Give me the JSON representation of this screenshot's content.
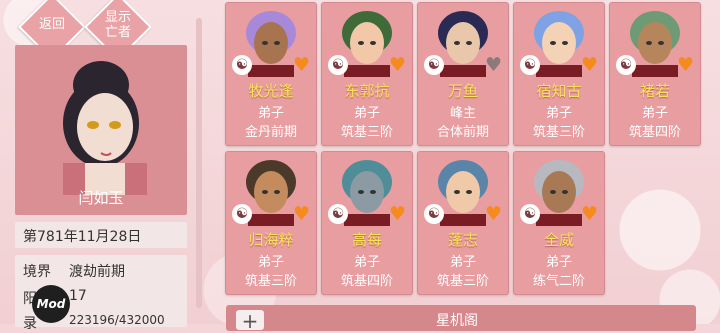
{
  "nav": {
    "back_label": "返回",
    "show_dead_label": "显示\n亡者"
  },
  "character": {
    "name": "闫如玉",
    "date": "第781年11月28日",
    "realm_label": "境界",
    "realm_value": "渡劫前期",
    "age_prefix": "阳",
    "age_value": "17",
    "exp_prefix": "录",
    "exp_value": "223196/432000"
  },
  "disciples": [
    {
      "name": "牧光逢",
      "role": "弟子",
      "rank": "金丹前期",
      "hair": "#a889d9",
      "skin": "#a8744f",
      "heart": "orange"
    },
    {
      "name": "东郭抗",
      "role": "弟子",
      "rank": "筑基三阶",
      "hair": "#3f6b3a",
      "skin": "#f2c8a8",
      "heart": "orange"
    },
    {
      "name": "万鱼",
      "role": "峰主",
      "rank": "合体前期",
      "hair": "#2a2a55",
      "skin": "#e9c7aa",
      "heart": "gray"
    },
    {
      "name": "宿知古",
      "role": "弟子",
      "rank": "筑基三阶",
      "hair": "#7ea2e4",
      "skin": "#f3d2b6",
      "heart": "orange"
    },
    {
      "name": "褚若",
      "role": "弟子",
      "rank": "筑基四阶",
      "hair": "#6f9a76",
      "skin": "#b7855b",
      "heart": "orange"
    },
    {
      "name": "归海粹",
      "role": "弟子",
      "rank": "筑基三阶",
      "hair": "#4b3a2a",
      "skin": "#c48c5e",
      "heart": "orange"
    },
    {
      "name": "高每",
      "role": "弟子",
      "rank": "筑基四阶",
      "hair": "#4f8d99",
      "skin": "#8c9aa3",
      "heart": "orange"
    },
    {
      "name": "蓬志",
      "role": "弟子",
      "rank": "筑基三阶",
      "hair": "#5b84a9",
      "skin": "#f0c9a8",
      "heart": "orange"
    },
    {
      "name": "全威",
      "role": "弟子",
      "rank": "练气二阶",
      "hair": "#b8b8c0",
      "skin": "#a77a55",
      "heart": "orange"
    }
  ],
  "bottom": {
    "plus_label": "+",
    "title": "星机阁"
  },
  "badge": "Mod",
  "colors": {
    "card_bg": "#e89ea1",
    "name_yellow": "#ffe15a",
    "heart_orange": "#f58a1f"
  }
}
